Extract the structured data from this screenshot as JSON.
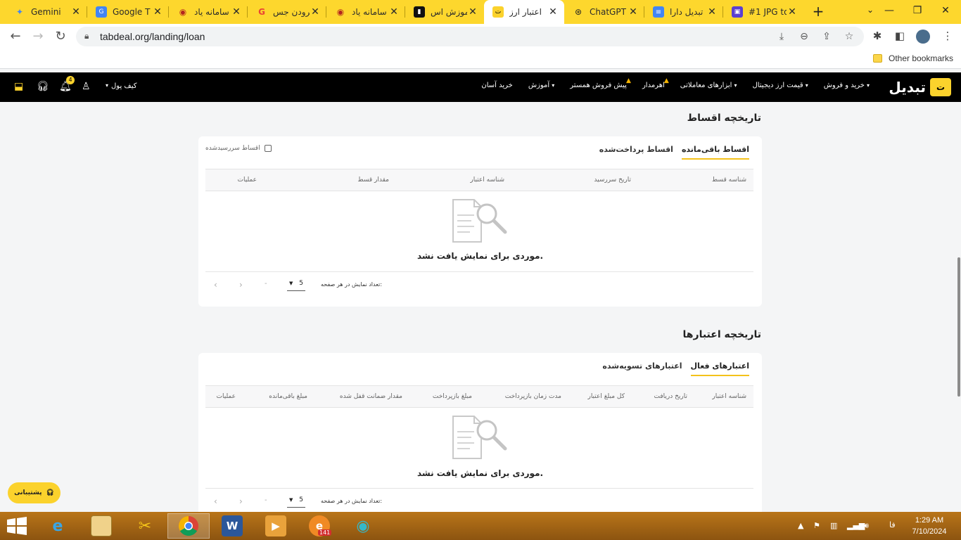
{
  "browser": {
    "tabs": [
      {
        "title": "Gemini",
        "icon": "gemini-icon"
      },
      {
        "title": "Google T",
        "icon": "google-translate-icon"
      },
      {
        "title": "سامانه یاد",
        "icon": "seal-icon"
      },
      {
        "title": "فرودن جس",
        "icon": "google-icon"
      },
      {
        "title": "سامانه یاد",
        "icon": "seal-icon"
      },
      {
        "title": "آموزش اس",
        "icon": "app-icon"
      },
      {
        "title": "اعتبار ارز",
        "icon": "tabdeal-icon"
      },
      {
        "title": "ChatGPT",
        "icon": "chatgpt-icon"
      },
      {
        "title": "تبدیل دارا",
        "icon": "docs-icon"
      },
      {
        "title": "#1 JPG to",
        "icon": "converter-icon"
      }
    ],
    "url": "tabdeal.org/landing/loan",
    "bookmark_folder": "Other bookmarks"
  },
  "site": {
    "brand": "تبدیل",
    "nav": [
      {
        "label": "خرید و فروش",
        "caret": true,
        "flame": false
      },
      {
        "label": "قیمت ارز دیجیتال",
        "caret": true,
        "flame": false
      },
      {
        "label": "ابزارهای معاملاتی",
        "caret": true,
        "flame": false
      },
      {
        "label": "اهرمدار",
        "caret": false,
        "flame": true
      },
      {
        "label": "پیش فروش همستر",
        "caret": false,
        "flame": true
      },
      {
        "label": "آموزش",
        "caret": true,
        "flame": false
      },
      {
        "label": "خرید آسان",
        "caret": false,
        "flame": false
      }
    ],
    "wallet_label": "کیف پول",
    "notification_count": "4"
  },
  "installments": {
    "title": "تاریخچه اقساط",
    "tabs": [
      {
        "label": "اقساط باقی‌مانده",
        "active": true
      },
      {
        "label": "اقساط پرداخت‌شده",
        "active": false
      }
    ],
    "overdue_label": "اقساط سررسیدشده",
    "columns": [
      "شناسه قسط",
      "تاریخ سررسید",
      "شناسه اعتبار",
      "مقدار قسط",
      "عملیات"
    ],
    "empty_text": "موردی برای نمایش یافت نشد.",
    "page_size": "5",
    "page_size_label": "تعداد نمایش در هر صفحه:",
    "range_text": "-"
  },
  "credits": {
    "title": "تاریخچه اعتبارها",
    "tabs": [
      {
        "label": "اعتبارهای فعال",
        "active": true
      },
      {
        "label": "اعتبارهای تسویه‌شده",
        "active": false
      }
    ],
    "columns": [
      "شناسه اعتبار",
      "تاریخ دریافت",
      "کل مبلغ اعتبار",
      "مدت زمان بازپرداخت",
      "مبلغ بازپرداخت",
      "مقدار ضمانت قفل شده",
      "مبلغ باقی‌مانده",
      "عملیات"
    ],
    "empty_text": "موردی برای نمایش یافت نشد.",
    "page_size": "5",
    "page_size_label": "تعداد نمایش در هر صفحه:",
    "range_text": "-"
  },
  "support_label": "پشتیبانی",
  "taskbar": {
    "lang": "فا",
    "time": "1:29 AM",
    "date": "7/10/2024",
    "badge": "141"
  },
  "colors": {
    "accent": "#fbd22c",
    "header_bg": "#000000",
    "page_bg": "#f4f5f6"
  }
}
